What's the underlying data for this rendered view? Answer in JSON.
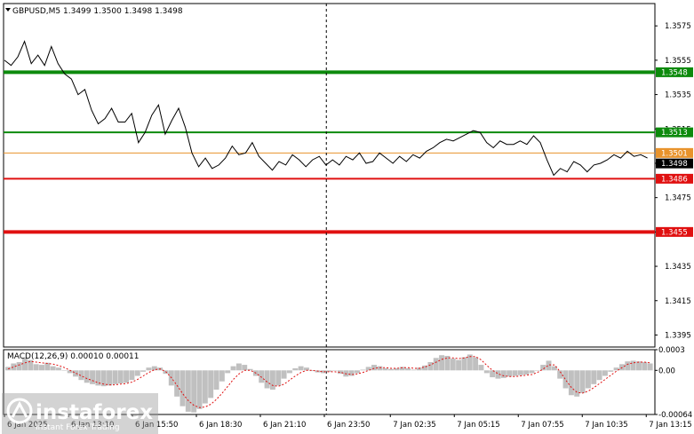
{
  "chart_data": [
    {
      "type": "line",
      "panel": "price",
      "title": "GBPUSD,M5  1.3499 1.3500 1.3498 1.3498",
      "symbol": "GBPUSD,M5",
      "ohlc": [
        "1.3499",
        "1.3500",
        "1.3498",
        "1.3498"
      ],
      "ylim": [
        1.3388,
        1.3588
      ],
      "y_ticks": [
        "1.3575",
        "1.3555",
        "1.3535",
        "1.3515",
        "1.3495",
        "1.3475",
        "1.3455",
        "1.3435",
        "1.3415",
        "1.3395"
      ],
      "x_ticks": [
        {
          "label": "6 Jan 2025",
          "bar": 0
        },
        {
          "label": "6 Jan 13:10",
          "bar": 32
        },
        {
          "label": "6 Jan 15:50",
          "bar": 64
        },
        {
          "label": "6 Jan 18:30",
          "bar": 96
        },
        {
          "label": "6 Jan 21:10",
          "bar": 128
        },
        {
          "label": "6 Jan 23:50",
          "bar": 160
        },
        {
          "label": "7 Jan 02:35",
          "bar": 193
        },
        {
          "label": "7 Jan 05:15",
          "bar": 225
        },
        {
          "label": "7 Jan 07:55",
          "bar": 257
        },
        {
          "label": "7 Jan 10:35",
          "bar": 289
        },
        {
          "label": "7 Jan 13:15",
          "bar": 321
        }
      ],
      "period_separator_bar": 161,
      "series": [
        {
          "values": [
            1.3555,
            1.3552,
            1.3557,
            1.3566,
            1.3553,
            1.3558,
            1.3552,
            1.3563,
            1.3553,
            1.3547,
            1.3544,
            1.3535,
            1.3538,
            1.3526,
            1.3518,
            1.3521,
            1.3527,
            1.3519,
            1.3519,
            1.3524,
            1.3507,
            1.3513,
            1.3523,
            1.3529,
            1.3512,
            1.352,
            1.3527,
            1.3516,
            1.3501,
            1.3493,
            1.3498,
            1.3492,
            1.3494,
            1.3498,
            1.3505,
            1.35,
            1.3501,
            1.3507,
            1.3499,
            1.3495,
            1.3491,
            1.3496,
            1.3494,
            1.35,
            1.3497,
            1.3493,
            1.3497,
            1.3499,
            1.3494,
            1.3497,
            1.3494,
            1.3499,
            1.3497,
            1.3501,
            1.3495,
            1.3496,
            1.3501,
            1.3498,
            1.3495,
            1.3499,
            1.3496,
            1.35,
            1.3498,
            1.3502,
            1.3504,
            1.3507,
            1.3509,
            1.3508,
            1.351,
            1.3512,
            1.3514,
            1.3513,
            1.3507,
            1.3504,
            1.3508,
            1.3506,
            1.3506,
            1.3508,
            1.3506,
            1.3511,
            1.3507,
            1.3497,
            1.3488,
            1.3492,
            1.349,
            1.3496,
            1.3494,
            1.349,
            1.3494,
            1.3495,
            1.3497,
            1.35,
            1.3498,
            1.3502,
            1.3499,
            1.35,
            1.3498
          ],
          "bars_per_point": 3.35,
          "start_bar": 0
        }
      ],
      "levels": [
        {
          "value": "1.3548",
          "color": "#0c8a0c",
          "thickness": "thick"
        },
        {
          "value": "1.3513",
          "color": "#0c8a0c",
          "thickness": "thin"
        },
        {
          "value": "1.3501",
          "color": "#e8932c",
          "thickness": "hair"
        },
        {
          "value": "1.3486",
          "color": "#e01010",
          "thickness": "thin"
        },
        {
          "value": "1.3455",
          "color": "#e01010",
          "thickness": "thick"
        }
      ],
      "current_price": {
        "value": "1.3498",
        "label": "1.3498"
      },
      "grid": false,
      "colors": {
        "background": "#ffffff",
        "price_line": "#000000",
        "axis": "#000000"
      }
    },
    {
      "type": "bar",
      "panel": "indicator",
      "title": "MACD(12,26,9) 0.00010 0.00011",
      "name": "MACD(12,26,9)",
      "values_text": [
        "0.00010",
        "0.00011"
      ],
      "y_ticks": [
        "0.0003",
        "0.00",
        "-0.00064"
      ],
      "ylim": [
        -0.00064,
        0.0003
      ],
      "histogram": [
        5e-05,
        0.0001,
        0.00012,
        0.00018,
        0.00015,
        9e-05,
        8e-05,
        0.00011,
        6e-05,
        4e-05,
        0.0,
        -4e-05,
        -9e-05,
        -0.00014,
        -0.00018,
        -0.0002,
        -0.00022,
        -0.00023,
        -0.00022,
        -0.0002,
        -0.00019,
        -0.00018,
        -0.00014,
        -8e-05,
        -2e-05,
        4e-05,
        6e-05,
        4e-05,
        -5e-05,
        -0.00022,
        -0.00038,
        -0.00052,
        -0.0006,
        -0.00061,
        -0.00056,
        -0.00048,
        -0.0004,
        -0.00028,
        -0.00016,
        -4e-05,
        6e-05,
        0.0001,
        8e-05,
        2e-05,
        -8e-05,
        -0.00018,
        -0.00026,
        -0.00028,
        -0.00022,
        -0.00012,
        -4e-05,
        3e-05,
        6e-05,
        4e-05,
        -1e-05,
        -3e-05,
        -4e-05,
        -2e-05,
        0.0,
        -5e-05,
        -9e-05,
        -8e-05,
        -4e-05,
        1e-05,
        5e-05,
        8e-05,
        6e-05,
        3e-05,
        2e-05,
        3e-05,
        5e-05,
        3e-05,
        1e-05,
        4e-05,
        7e-05,
        0.00012,
        0.00018,
        0.00022,
        0.00021,
        0.00017,
        0.00015,
        0.00019,
        0.00023,
        0.00019,
        8e-05,
        -4e-05,
        -0.0001,
        -0.00012,
        -0.00011,
        -9e-05,
        -8e-05,
        -7e-05,
        -6e-05,
        -4e-05,
        0.0,
        8e-05,
        0.00014,
        6e-05,
        -0.00012,
        -0.00026,
        -0.00036,
        -0.00038,
        -0.00033,
        -0.00026,
        -0.0002,
        -0.00014,
        -8e-05,
        -2e-05,
        4e-05,
        9e-05,
        0.00013,
        0.00014,
        0.00013,
        0.00012,
        0.0001
      ],
      "signal": [
        2e-05,
        5e-05,
        8e-05,
        0.00011,
        0.00013,
        0.00012,
        0.00011,
        0.0001,
        9e-05,
        7e-05,
        4e-05,
        0.0,
        -4e-05,
        -8e-05,
        -0.00012,
        -0.00015,
        -0.00018,
        -0.0002,
        -0.00021,
        -0.00021,
        -0.0002,
        -0.00019,
        -0.00017,
        -0.00013,
        -8e-05,
        -3e-05,
        1e-05,
        2e-05,
        -2e-05,
        -0.00011,
        -0.00022,
        -0.00034,
        -0.00044,
        -0.00051,
        -0.00054,
        -0.00053,
        -0.00049,
        -0.00042,
        -0.00033,
        -0.00023,
        -0.00013,
        -5e-05,
        0.0,
        0.0,
        -4e-05,
        -0.0001,
        -0.00017,
        -0.00022,
        -0.00023,
        -0.0002,
        -0.00014,
        -8e-05,
        -3e-05,
        0.0,
        0.0,
        -1e-05,
        -2e-05,
        -2e-05,
        -2e-05,
        -3e-05,
        -5e-05,
        -6e-05,
        -5e-05,
        -3e-05,
        0.0,
        3e-05,
        4e-05,
        4e-05,
        3e-05,
        3e-05,
        4e-05,
        4e-05,
        3e-05,
        3e-05,
        5e-05,
        8e-05,
        0.00012,
        0.00016,
        0.00018,
        0.00018,
        0.00017,
        0.00018,
        0.0002,
        0.0002,
        0.00015,
        7e-05,
        0.0,
        -5e-05,
        -8e-05,
        -9e-05,
        -9e-05,
        -8e-05,
        -7e-05,
        -6e-05,
        -3e-05,
        2e-05,
        8e-05,
        8e-05,
        -2e-05,
        -0.00014,
        -0.00025,
        -0.00032,
        -0.00033,
        -0.0003,
        -0.00025,
        -0.00019,
        -0.00013,
        -7e-05,
        -1e-05,
        4e-05,
        9e-05,
        0.00011,
        0.00012,
        0.00012,
        0.00011
      ],
      "colors": {
        "histogram": "#c0c0c0",
        "signal": "#e01010"
      }
    }
  ],
  "watermark": {
    "brand": "instaforex",
    "tagline": "Instant Forex Trading",
    "color": "#ffffff"
  }
}
